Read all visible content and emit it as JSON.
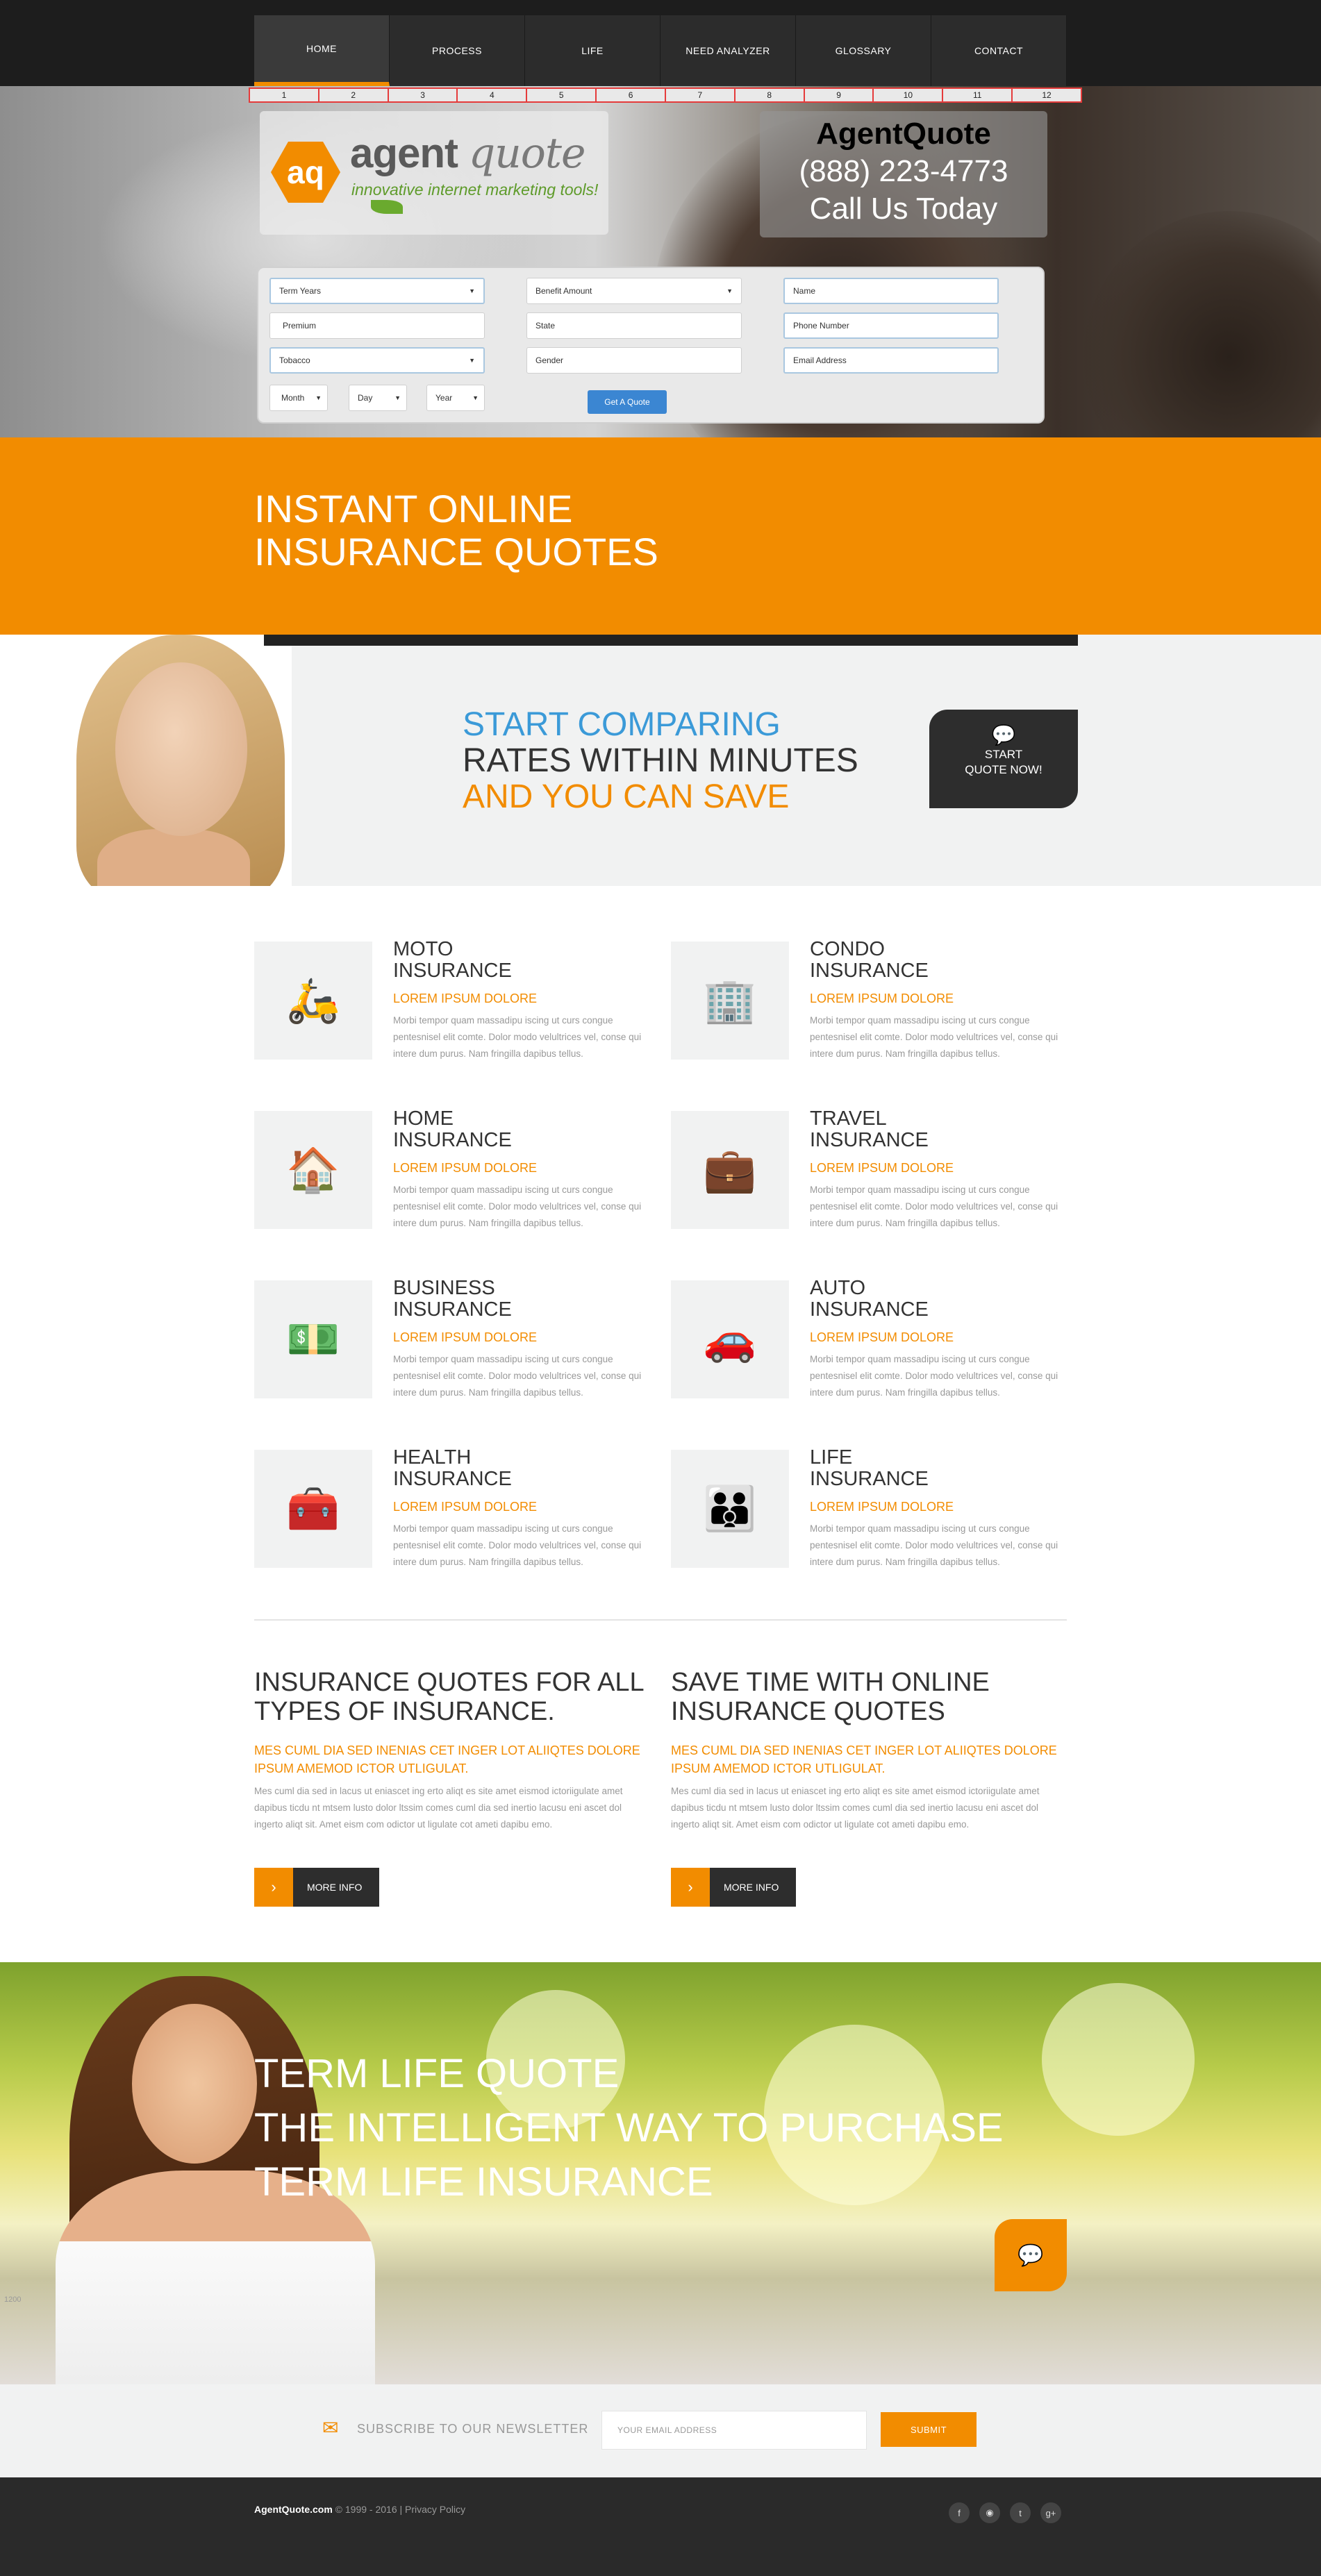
{
  "nav": {
    "items": [
      "HOME",
      "PROCESS",
      "LIFE",
      "NEED ANALYZER",
      "GLOSSARY",
      "CONTACT"
    ],
    "active": 0
  },
  "grid_numbers": [
    "1",
    "2",
    "3",
    "4",
    "5",
    "6",
    "7",
    "8",
    "9",
    "10",
    "11",
    "12"
  ],
  "logo": {
    "mark": "aq",
    "word": "agent",
    "word_italic": "quote",
    "tagline": "innovative internet marketing tools!"
  },
  "contact": {
    "title": "AgentQuote",
    "phone": "(888) 223-4773",
    "cta": "Call Us Today"
  },
  "form": {
    "term_years": "Term Years",
    "benefit_amount": "Benefit Amount",
    "name": "Name",
    "premium": "Premium",
    "state": "State",
    "phone_number": "Phone Number",
    "tobacco": "Tobacco",
    "gender": "Gender",
    "email": "Email Address",
    "month": "Month",
    "day": "Day",
    "year": "Year",
    "button": "Get A Quote"
  },
  "banner": {
    "line1": "INSTANT ONLINE",
    "line2": "INSURANCE QUOTES"
  },
  "compare": {
    "line1": "START COMPARING",
    "line2": "RATES WITHIN MINUTES",
    "line3": "AND YOU CAN SAVE",
    "button_line1": "START",
    "button_line2": "QUOTE NOW!"
  },
  "services": [
    {
      "title1": "MOTO",
      "title2": "INSURANCE",
      "sub": "LOREM IPSUM DOLORE",
      "text": "Morbi tempor quam massadipu iscing ut curs congue pentesnisel elit comte. Dolor modo velultrices vel, conse qui intere dum purus. Nam fringilla dapibus tellus.",
      "icon": "moto-icon"
    },
    {
      "title1": "CONDO",
      "title2": "INSURANCE",
      "sub": "LOREM IPSUM DOLORE",
      "text": "Morbi tempor quam massadipu iscing ut curs congue pentesnisel elit comte. Dolor modo velultrices vel, conse qui intere dum purus. Nam fringilla dapibus tellus.",
      "icon": "condo-icon"
    },
    {
      "title1": "HOME",
      "title2": "INSURANCE",
      "sub": "LOREM IPSUM DOLORE",
      "text": "Morbi tempor quam massadipu iscing ut curs congue pentesnisel elit comte. Dolor modo velultrices vel, conse qui intere dum purus. Nam fringilla dapibus tellus.",
      "icon": "home-icon"
    },
    {
      "title1": "TRAVEL",
      "title2": "INSURANCE",
      "sub": "LOREM IPSUM DOLORE",
      "text": "Morbi tempor quam massadipu iscing ut curs congue pentesnisel elit comte. Dolor modo velultrices vel, conse qui intere dum purus. Nam fringilla dapibus tellus.",
      "icon": "suitcase-icon"
    },
    {
      "title1": "BUSINESS",
      "title2": "INSURANCE",
      "sub": "LOREM IPSUM DOLORE",
      "text": "Morbi tempor quam massadipu iscing ut curs congue pentesnisel elit comte. Dolor modo velultrices vel, conse qui intere dum purus. Nam fringilla dapibus tellus.",
      "icon": "money-icon"
    },
    {
      "title1": "AUTO",
      "title2": "INSURANCE",
      "sub": "LOREM IPSUM DOLORE",
      "text": "Morbi tempor quam massadipu iscing ut curs congue pentesnisel elit comte. Dolor modo velultrices vel, conse qui intere dum purus. Nam fringilla dapibus tellus.",
      "icon": "car-icon"
    },
    {
      "title1": "HEALTH",
      "title2": "INSURANCE",
      "sub": "LOREM IPSUM DOLORE",
      "text": "Morbi tempor quam massadipu iscing ut curs congue pentesnisel elit comte. Dolor modo velultrices vel, conse qui intere dum purus. Nam fringilla dapibus tellus.",
      "icon": "medkit-icon"
    },
    {
      "title1": "LIFE",
      "title2": "INSURANCE",
      "sub": "LOREM IPSUM DOLORE",
      "text": "Morbi tempor quam massadipu iscing ut curs congue pentesnisel elit comte. Dolor modo velultrices vel, conse qui intere dum purus. Nam fringilla dapibus tellus.",
      "icon": "family-icon"
    }
  ],
  "info": [
    {
      "title": "INSURANCE QUOTES FOR ALL TYPES OF INSURANCE.",
      "sub": "MES CUML DIA SED INENIAS CET INGER LOT ALIIQTES DOLORE IPSUM AMEMOD ICTOR UTLIGULAT.",
      "text": "Mes cuml dia sed in lacus ut eniascet ing erto aliqt es site amet eismod ictoriigulate amet dapibus ticdu nt mtsem lusto dolor ltssim comes cuml dia sed inertio lacusu eni ascet dol ingerto aliqt sit. Amet eism com odictor ut ligulate cot ameti dapibu emo.",
      "button": "MORE INFO"
    },
    {
      "title": "SAVE TIME WITH ONLINE INSURANCE QUOTES",
      "sub": "MES CUML DIA SED INENIAS CET INGER LOT ALIIQTES DOLORE IPSUM AMEMOD ICTOR UTLIGULAT.",
      "text": "Mes cuml dia sed in lacus ut eniascet ing erto aliqt es site amet eismod ictoriigulate amet dapibus ticdu nt mtsem lusto dolor ltssim comes cuml dia sed inertio lacusu eni ascet dol ingerto aliqt sit. Amet eism com odictor ut ligulate cot ameti dapibu emo.",
      "button": "MORE INFO"
    }
  ],
  "term": {
    "line1": "TERM LIFE QUOTE",
    "line2": "THE INTELLIGENT WAY TO PURCHASE",
    "line3": "TERM LIFE INSURANCE",
    "side_label": "1200"
  },
  "newsletter": {
    "label": "SUBSCRIBE TO OUR NEWSLETTER",
    "placeholder": "YOUR EMAIL ADDRESS",
    "button": "SUBMIT"
  },
  "footer": {
    "brand": "AgentQuote.com",
    "copy": " © 1999 - 2016 | Privacy Policy"
  },
  "colors": {
    "accent": "#f28c00",
    "blue": "#3b9ad8",
    "dark": "#2d2d2d"
  }
}
